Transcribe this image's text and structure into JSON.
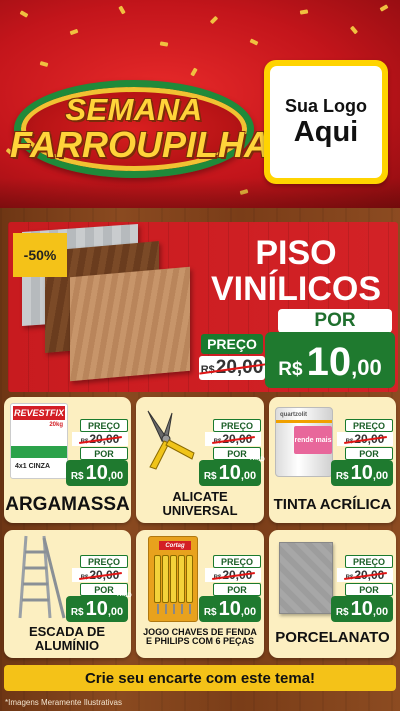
{
  "header": {
    "event_title_line1": "SEMANA",
    "event_title_line2": "FARROUPILHA",
    "logo_placeholder_line1": "Sua Logo",
    "logo_placeholder_line2": "Aqui"
  },
  "featured": {
    "discount": "-50%",
    "title_line1": "PISO",
    "title_line2": "VINÍLICOS",
    "preco_label": "PREÇO",
    "por_label": "POR",
    "old_currency": "R$",
    "old_price": "20,00",
    "new_currency": "R$",
    "new_price_int": "10",
    "new_price_dec": ",00"
  },
  "products": [
    {
      "name": "ARGAMASSA",
      "brand": "REVESTFIX",
      "weight": "20kg",
      "variant": "4x1 CINZA",
      "preco_label": "PREÇO",
      "por_label": "POR",
      "old_currency": "R$",
      "old_price": "20,00",
      "new_currency": "R$",
      "new_price_int": "10",
      "new_price_dec": ",00"
    },
    {
      "name": "ALICATE UNIVERSAL",
      "preco_label": "PREÇO",
      "por_label": "POR",
      "unid": "UNID",
      "old_currency": "R$",
      "old_price": "20,00",
      "new_currency": "R$",
      "new_price_int": "10",
      "new_price_dec": ",00"
    },
    {
      "name": "TINTA ACRÍLICA",
      "brand": "quartzolit",
      "label": "rende mais",
      "preco_label": "PREÇO",
      "por_label": "POR",
      "old_currency": "R$",
      "old_price": "20,00",
      "new_currency": "R$",
      "new_price_int": "10",
      "new_price_dec": ",00"
    },
    {
      "name": "ESCADA DE ALUMÍNIO",
      "preco_label": "PREÇO",
      "por_label": "POR",
      "unid": "UNID",
      "old_currency": "R$",
      "old_price": "20,00",
      "new_currency": "R$",
      "new_price_int": "10",
      "new_price_dec": ",00"
    },
    {
      "name": "JOGO CHAVES DE FENDA E PHILIPS COM 6 PEÇAS",
      "brand": "Cortag",
      "preco_label": "PREÇO",
      "por_label": "POR",
      "old_currency": "R$",
      "old_price": "20,00",
      "new_currency": "R$",
      "new_price_int": "10",
      "new_price_dec": ",00"
    },
    {
      "name": "PORCELANATO",
      "preco_label": "PREÇO",
      "por_label": "POR",
      "old_currency": "R$",
      "old_price": "20,00",
      "new_currency": "R$",
      "new_price_int": "10",
      "new_price_dec": ",00"
    }
  ],
  "cta": "Crie seu encarte com este tema!",
  "disclaimer": "*Imagens Meramente Ilustrativas",
  "colors": {
    "header_red": "#c3151b",
    "price_green": "#1f7a2f",
    "accent_yellow": "#f4c218",
    "card_cream": "#fcefc1"
  }
}
